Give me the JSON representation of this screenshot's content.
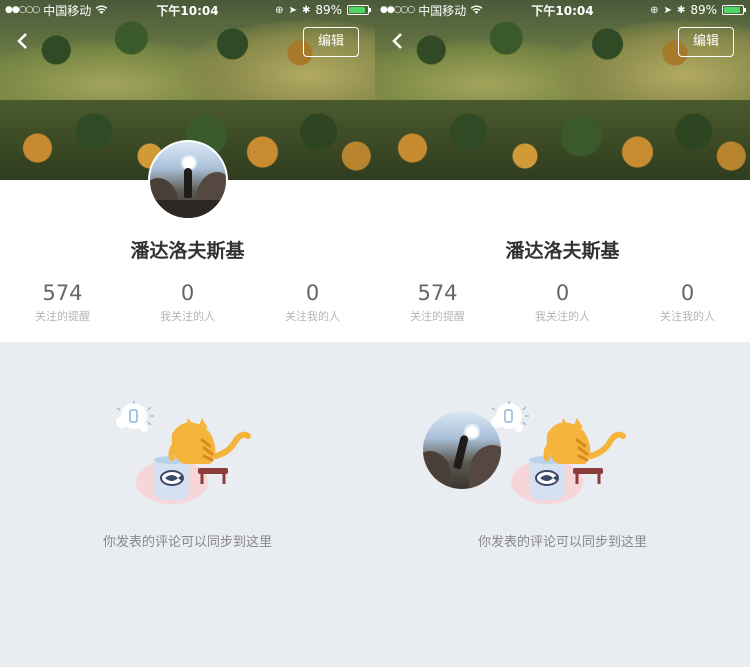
{
  "status": {
    "carrier": "中国移动",
    "time": "下午10:04",
    "battery": "89%",
    "battery_level": 0.89,
    "signal_dots": "●●○○○"
  },
  "nav": {
    "back_icon": "‹",
    "edit_label": "编辑"
  },
  "profile": {
    "name": "潘达洛夫斯基",
    "stats": [
      {
        "value": "574",
        "label": "关注的提醒"
      },
      {
        "value": "0",
        "label": "我关注的人"
      },
      {
        "value": "0",
        "label": "关注我的人"
      }
    ]
  },
  "empty": {
    "message": "你发表的评论可以同步到这里"
  },
  "colors": {
    "background": "#e9ecf1",
    "battery_green": "#4cd964",
    "cat_orange": "#f5b43c"
  }
}
